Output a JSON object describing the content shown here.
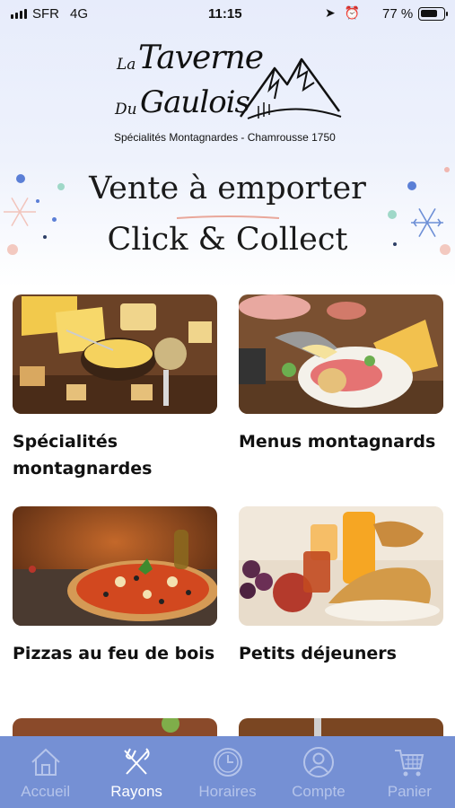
{
  "status_bar": {
    "carrier": "SFR",
    "network": "4G",
    "time": "11:15",
    "battery_percent": "77 %",
    "battery_level": 0.77,
    "icons": [
      "signal-icon",
      "location-icon",
      "alarm-icon",
      "battery-icon"
    ]
  },
  "logo": {
    "line1_small": "La",
    "line1_big": "Taverne",
    "line2_small": "Du",
    "line2_big": "Gaulois",
    "tagline": "Spécialités Montagnardes - Chamrousse 1750"
  },
  "headline": {
    "line1": "Vente à emporter",
    "line2": "Click & Collect"
  },
  "categories": [
    {
      "label": "Spécialités montagnardes",
      "image": "fondue-cheese-photo"
    },
    {
      "label": "Menus montagnards",
      "image": "raclette-photo"
    },
    {
      "label": "Pizzas au feu de bois",
      "image": "pizza-photo"
    },
    {
      "label": "Petits déjeuners",
      "image": "breakfast-photo"
    },
    {
      "label": "",
      "image": "partial-photo-left"
    },
    {
      "label": "",
      "image": "partial-photo-right"
    }
  ],
  "tab_bar": {
    "tabs": [
      {
        "label": "Accueil",
        "icon": "home-icon",
        "active": false
      },
      {
        "label": "Rayons",
        "icon": "fork-knife-icon",
        "active": true
      },
      {
        "label": "Horaires",
        "icon": "clock-icon",
        "active": false
      },
      {
        "label": "Compte",
        "icon": "user-icon",
        "active": false
      },
      {
        "label": "Panier",
        "icon": "cart-icon",
        "active": false
      }
    ]
  },
  "colors": {
    "tab_bar_bg": "#7590d4",
    "tab_active": "#ffffff",
    "tab_inactive": "#b5c4ea",
    "header_bg": "#e7ecfb"
  }
}
